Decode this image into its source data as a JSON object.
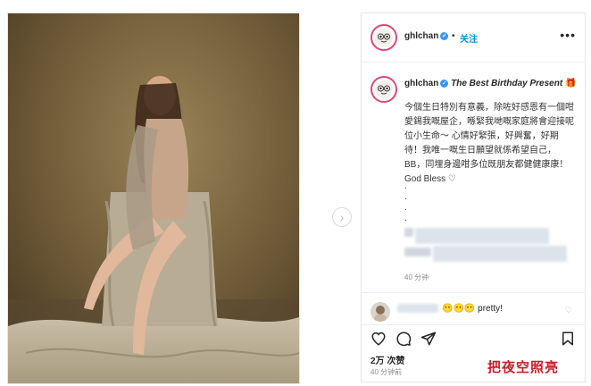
{
  "header": {
    "username": "ghlchan",
    "separator": "•",
    "follow_label": "关注",
    "more_label": "•••",
    "avatar_icon": "cartoon-avatar-icon",
    "verified_icon": "verified-badge-icon"
  },
  "caption": {
    "username": "ghlchan",
    "title": "The Best Birthday Present",
    "title_tail": " 🎁",
    "body": "今個生日特別有意義，除咗好感恩有一個咁愛錫我嘅屋企，喺緊我哋嘅家庭將會迎接呢位小生命～ 心情好緊張，好興奮，好期待！我唯一嘅生日願望就係希望自己，BB，同埋身邊咁多位既朋友都健健康康！God Bless ♡",
    "dots": [
      ".",
      ".",
      ".",
      "."
    ],
    "time": "40 分钟"
  },
  "comment": {
    "text": "😶😶😶 pretty!",
    "heart_icon": "heart-outline-icon"
  },
  "actions": {
    "like_icon": "heart-icon",
    "comment_icon": "comment-icon",
    "share_icon": "send-icon",
    "save_icon": "bookmark-icon"
  },
  "stats": {
    "likes": "2万 次赞",
    "time": "40 分钟前"
  },
  "carousel": {
    "next_icon": "chevron-right-icon",
    "next_label": "›"
  },
  "watermark": "把夜空照亮",
  "colors": {
    "accent": "#0095f6",
    "verified": "#3897f0",
    "avatar_ring": "#d94a77",
    "watermark": "#c8202a"
  }
}
